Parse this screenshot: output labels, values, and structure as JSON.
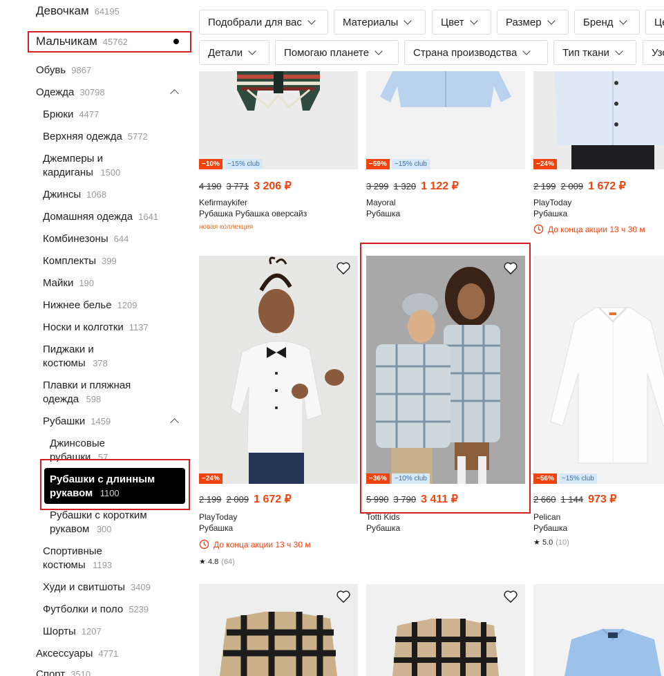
{
  "sidebar": {
    "girls": {
      "label": "Девочкам",
      "count": "64195"
    },
    "boys": {
      "label": "Мальчикам",
      "count": "45762"
    },
    "shoes": {
      "label": "Обувь",
      "count": "9867"
    },
    "clothes": {
      "label": "Одежда",
      "count": "30798"
    },
    "pants": {
      "label": "Брюки",
      "count": "4477"
    },
    "outerwear": {
      "label": "Верхняя одежда",
      "count": "5772"
    },
    "jumpers": {
      "label": "Джемперы и кардиганы",
      "count": "1500"
    },
    "jeans": {
      "label": "Джинсы",
      "count": "1068"
    },
    "homewear": {
      "label": "Домашняя одежда",
      "count": "1641"
    },
    "overalls": {
      "label": "Комбинезоны",
      "count": "644"
    },
    "sets": {
      "label": "Комплекты",
      "count": "399"
    },
    "tshirts_tank": {
      "label": "Майки",
      "count": "190"
    },
    "underwear": {
      "label": "Нижнее белье",
      "count": "1209"
    },
    "socks": {
      "label": "Носки и колготки",
      "count": "1137"
    },
    "suits": {
      "label": "Пиджаки и костюмы",
      "count": "378"
    },
    "swim": {
      "label": "Плавки и пляжная одежда",
      "count": "598"
    },
    "shirts": {
      "label": "Рубашки",
      "count": "1459"
    },
    "denim_shirts": {
      "label": "Джинсовые рубашки",
      "count": "57"
    },
    "long_sleeve": {
      "label": "Рубашки с длинным рукавом",
      "count": "1100"
    },
    "short_sleeve": {
      "label": "Рубашки с коротким рукавом",
      "count": "300"
    },
    "sport_suits": {
      "label": "Спортивные костюмы",
      "count": "1193"
    },
    "hoodies": {
      "label": "Худи и свитшоты",
      "count": "3409"
    },
    "tees_polo": {
      "label": "Футболки и поло",
      "count": "5239"
    },
    "shorts": {
      "label": "Шорты",
      "count": "1207"
    },
    "accessories": {
      "label": "Аксессуары",
      "count": "4771"
    },
    "sport": {
      "label": "Спорт",
      "count": "3510"
    }
  },
  "filters": {
    "row1": [
      "Подобрали для вас",
      "Материалы",
      "Цвет",
      "Размер",
      "Бренд",
      "Це"
    ],
    "row2": [
      "Детали",
      "Помогаю планете",
      "Страна производства",
      "Тип ткани",
      "Узо"
    ]
  },
  "products": [
    {
      "discount": "−10%",
      "club": "−15% club",
      "old1": "4 190",
      "old2": "3 771",
      "price": "3 206 ₽",
      "brand": "Kefirmaykifer",
      "title": "Рубашка Рубашка оверсайз",
      "note": "новая коллекция"
    },
    {
      "discount": "−59%",
      "club": "−15% club",
      "old1": "3 299",
      "old2": "1 320",
      "price": "1 122 ₽",
      "brand": "Mayoral",
      "title": "Рубашка"
    },
    {
      "discount": "−24%",
      "old1": "2 199",
      "old2": "2 009",
      "price": "1 672 ₽",
      "brand": "PlayToday",
      "title": "Рубашка",
      "timer": "До конца акции 13 ч 30 м"
    },
    {
      "discount": "−24%",
      "old1": "2 199",
      "old2": "2 009",
      "price": "1 672 ₽",
      "brand": "PlayToday",
      "title": "Рубашка",
      "timer": "До конца акции 13 ч 30 м",
      "rating": "4.8",
      "reviews": "(64)"
    },
    {
      "discount": "−36%",
      "club": "−10% club",
      "old1": "5 990",
      "old2": "3 790",
      "price": "3 411 ₽",
      "brand": "Totti Kids",
      "title": "Рубашка"
    },
    {
      "discount": "−56%",
      "club": "−15% club",
      "old1": "2 660",
      "old2": "1 144",
      "price": "973 ₽",
      "brand": "Pelican",
      "title": "Рубашка",
      "rating": "5.0",
      "reviews": "(10)"
    }
  ],
  "colors": {
    "accent": "#f0430e",
    "annotation": "#d41f1f",
    "club_bg": "#d6e9fb"
  },
  "icons": [
    "heart-icon",
    "chevron-down-icon",
    "chevron-up-icon",
    "clock-icon",
    "star-icon"
  ]
}
